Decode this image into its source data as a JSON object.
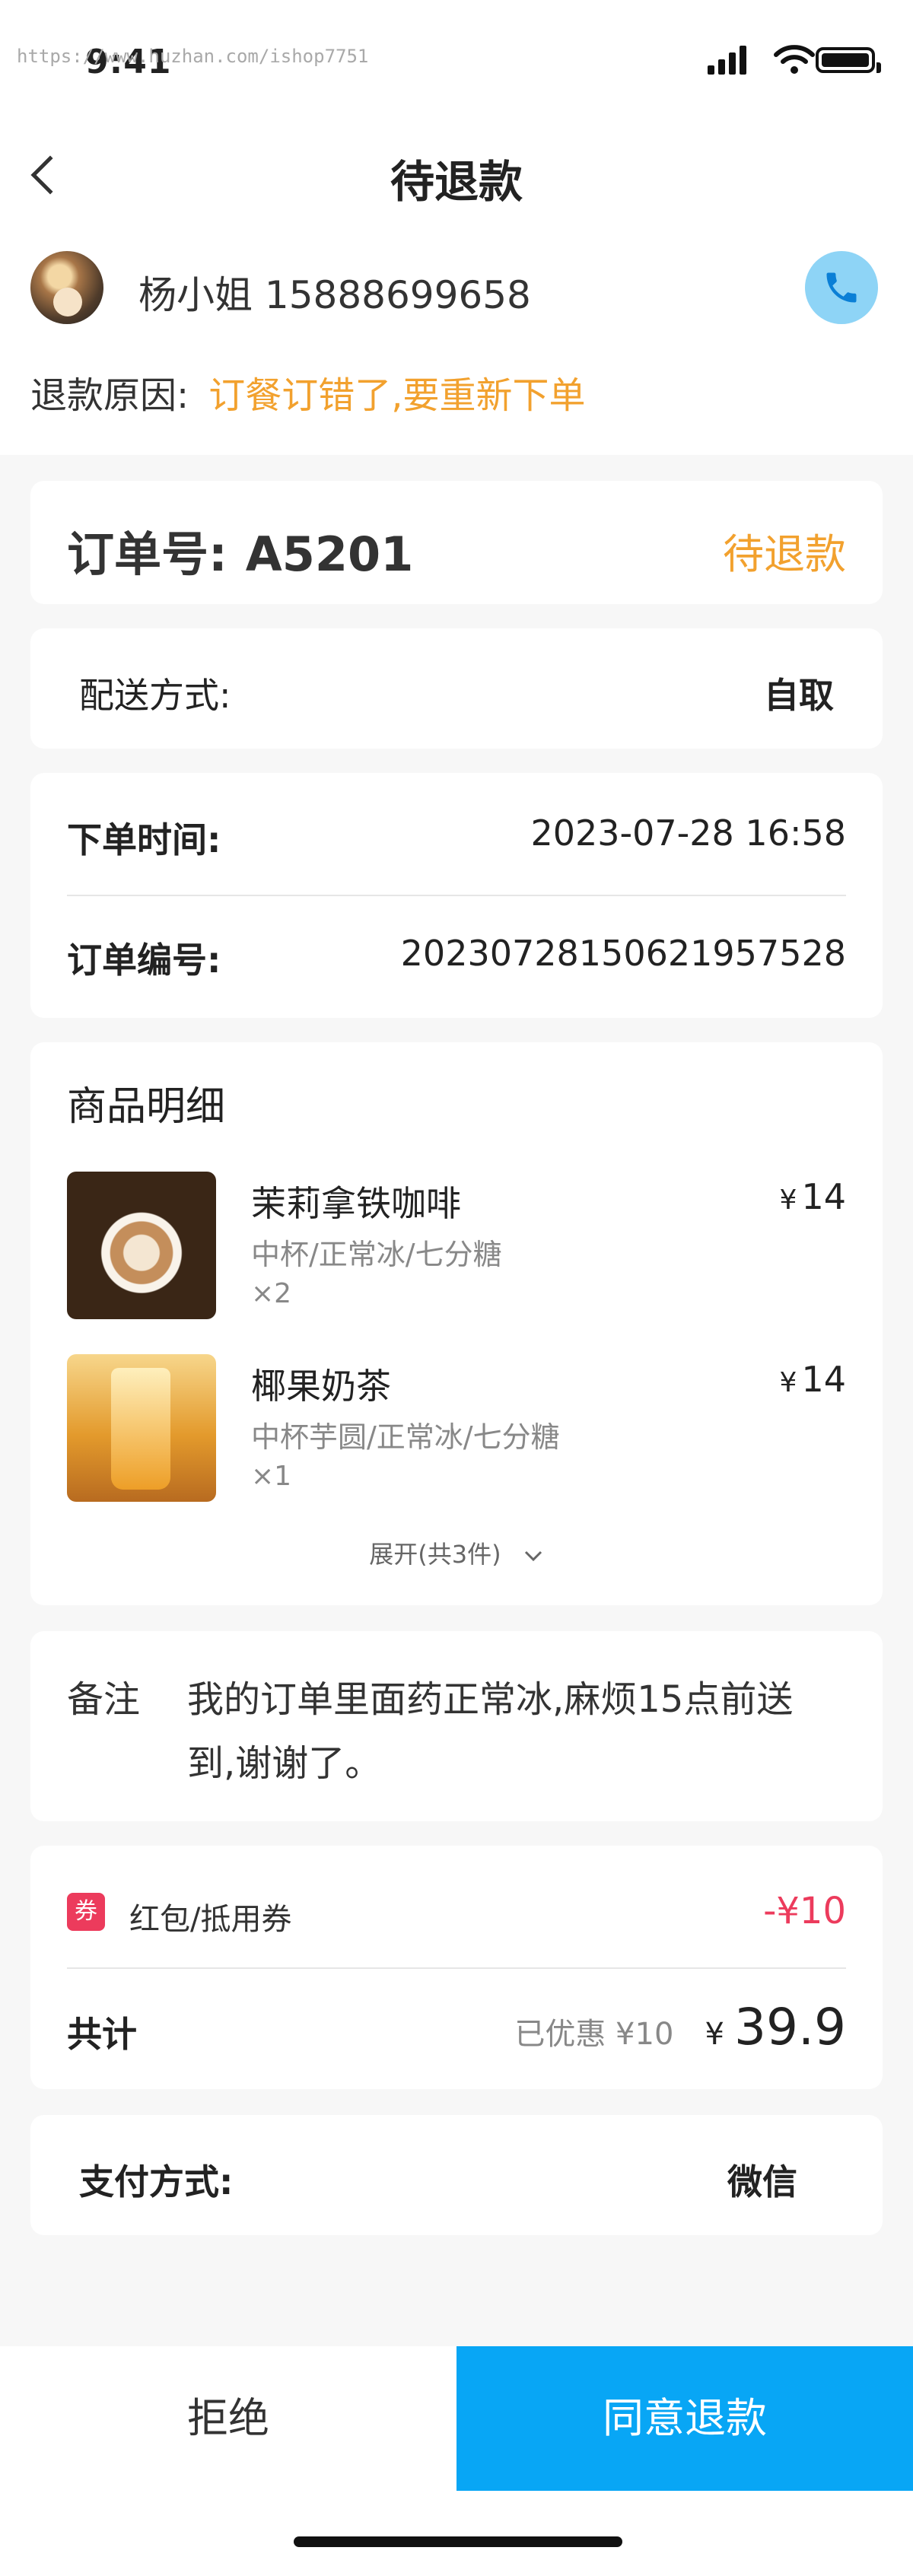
{
  "status_bar": {
    "time": "9:41",
    "watermark": "https://www.huzhan.com/ishop7751"
  },
  "nav": {
    "title": "待退款"
  },
  "customer": {
    "name_phone": "杨小姐 15888699658"
  },
  "refund": {
    "label": "退款原因:",
    "reason": "订餐订错了,要重新下单"
  },
  "order": {
    "number_label": "订单号:",
    "number": "A5201",
    "status": "待退款"
  },
  "delivery": {
    "label": "配送方式:",
    "value": "自取"
  },
  "info": {
    "time_label": "下单时间:",
    "time_value": "2023-07-28 16:58",
    "serial_label": "订单编号:",
    "serial_value": "20230728150621957528"
  },
  "goods": {
    "title": "商品明细",
    "items": [
      {
        "name": "茉莉拿铁咖啡",
        "spec": "中杯/正常冰/七分糖",
        "qty": "×2",
        "currency": "¥",
        "price": "14"
      },
      {
        "name": "椰果奶茶",
        "spec": "中杯芋圆/正常冰/七分糖",
        "qty": "×1",
        "currency": "¥",
        "price": "14"
      }
    ],
    "expand": "展开(共3件)"
  },
  "remark": {
    "label": "备注",
    "line1": "我的订单里面药正常冰,麻烦15点前送",
    "line2": "到,谢谢了。"
  },
  "coupon": {
    "badge": "券",
    "label": "红包/抵用券",
    "value": "-¥10"
  },
  "total": {
    "label": "共计",
    "discount": "已优惠 ¥10",
    "currency": "¥",
    "amount": "39.9"
  },
  "payment": {
    "label": "支付方式:",
    "value": "微信"
  },
  "actions": {
    "reject": "拒绝",
    "agree": "同意退款"
  },
  "colors": {
    "accent_blue": "#08a6f5",
    "accent_orange": "#f2a12e",
    "coupon_red": "#ec3b5c"
  }
}
